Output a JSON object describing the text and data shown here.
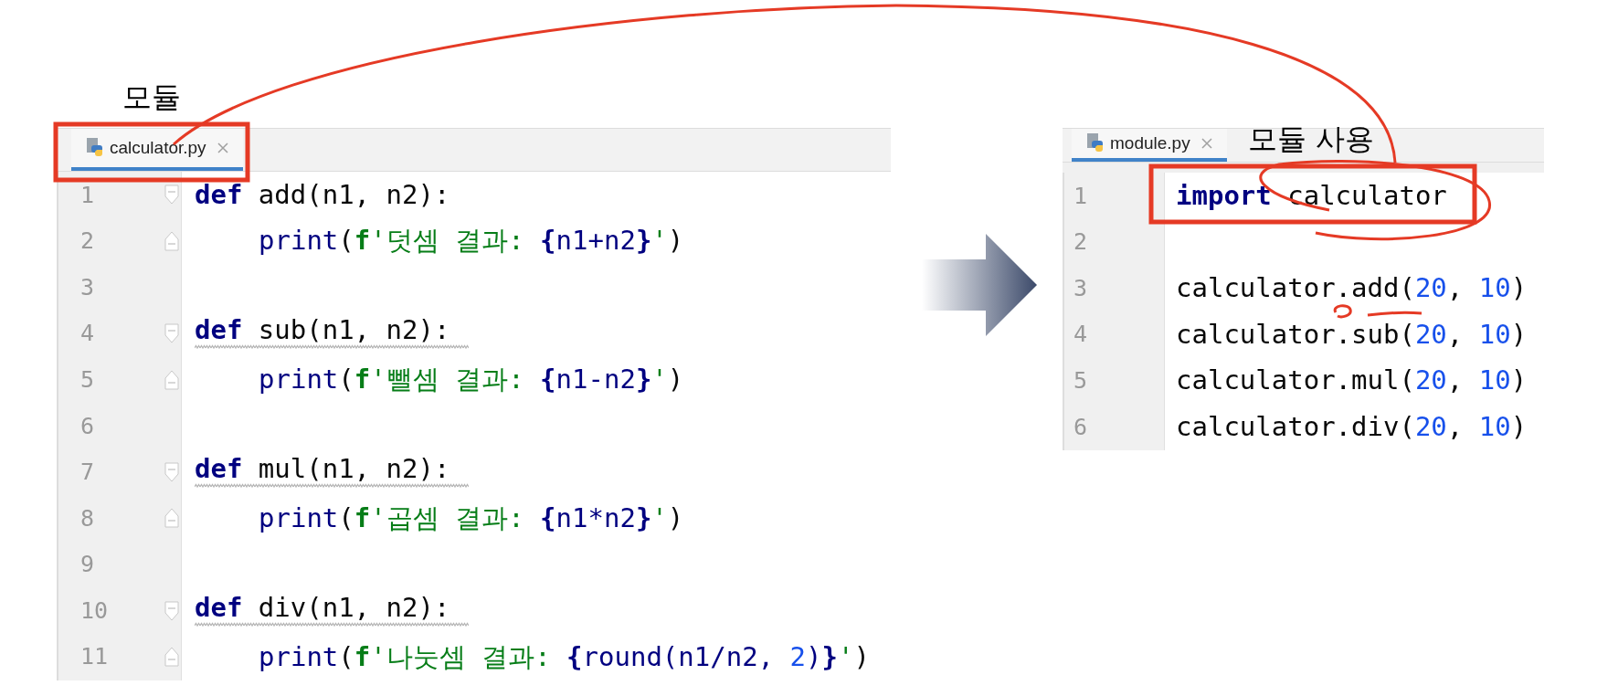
{
  "labels": [
    {
      "text": "모듈",
      "kind": "module"
    },
    {
      "text": "모듈 사용",
      "kind": "usage"
    }
  ],
  "editors": [
    {
      "tab": {
        "label": "calculator.py",
        "selected": true
      },
      "lines": [
        {
          "number": "1",
          "kind": "def",
          "warning": false,
          "tokens": [
            {
              "text": "def",
              "kind": "keyword"
            },
            {
              "text": " add(n1, n2):",
              "kind": "plain"
            }
          ]
        },
        {
          "number": "2",
          "kind": "body",
          "warning": false,
          "tokens": [
            {
              "text": "print",
              "kind": "builtin"
            },
            {
              "text": "(",
              "kind": "plain"
            },
            {
              "text": "f",
              "kind": "prefix"
            },
            {
              "text": "'덧셈 결과: ",
              "kind": "string"
            },
            {
              "text": "{",
              "kind": "brace"
            },
            {
              "text": "n1+n2",
              "kind": "expr"
            },
            {
              "text": "}",
              "kind": "brace"
            },
            {
              "text": "'",
              "kind": "string"
            },
            {
              "text": ")",
              "kind": "plain"
            }
          ]
        },
        {
          "number": "3",
          "kind": "blank"
        },
        {
          "number": "4",
          "kind": "def",
          "warning": true,
          "tokens": [
            {
              "text": "def",
              "kind": "keyword"
            },
            {
              "text": " sub(n1, n2):",
              "kind": "plain"
            }
          ]
        },
        {
          "number": "5",
          "kind": "body",
          "warning": false,
          "tokens": [
            {
              "text": "print",
              "kind": "builtin"
            },
            {
              "text": "(",
              "kind": "plain"
            },
            {
              "text": "f",
              "kind": "prefix"
            },
            {
              "text": "'뺄셈 결과: ",
              "kind": "string"
            },
            {
              "text": "{",
              "kind": "brace"
            },
            {
              "text": "n1-n2",
              "kind": "expr"
            },
            {
              "text": "}",
              "kind": "brace"
            },
            {
              "text": "'",
              "kind": "string"
            },
            {
              "text": ")",
              "kind": "plain"
            }
          ]
        },
        {
          "number": "6",
          "kind": "blank"
        },
        {
          "number": "7",
          "kind": "def",
          "warning": true,
          "tokens": [
            {
              "text": "def",
              "kind": "keyword"
            },
            {
              "text": " mul(n1, n2):",
              "kind": "plain"
            }
          ]
        },
        {
          "number": "8",
          "kind": "body",
          "warning": false,
          "tokens": [
            {
              "text": "print",
              "kind": "builtin"
            },
            {
              "text": "(",
              "kind": "plain"
            },
            {
              "text": "f",
              "kind": "prefix"
            },
            {
              "text": "'곱셈 결과: ",
              "kind": "string"
            },
            {
              "text": "{",
              "kind": "brace"
            },
            {
              "text": "n1*n2",
              "kind": "expr"
            },
            {
              "text": "}",
              "kind": "brace"
            },
            {
              "text": "'",
              "kind": "string"
            },
            {
              "text": ")",
              "kind": "plain"
            }
          ]
        },
        {
          "number": "9",
          "kind": "blank"
        },
        {
          "number": "10",
          "kind": "def",
          "warning": true,
          "tokens": [
            {
              "text": "def",
              "kind": "keyword"
            },
            {
              "text": " div(n1, n2):",
              "kind": "plain"
            }
          ]
        },
        {
          "number": "11",
          "kind": "body",
          "warning": false,
          "tokens": [
            {
              "text": "print",
              "kind": "builtin"
            },
            {
              "text": "(",
              "kind": "plain"
            },
            {
              "text": "f",
              "kind": "prefix"
            },
            {
              "text": "'나눗셈 결과: ",
              "kind": "string"
            },
            {
              "text": "{",
              "kind": "brace"
            },
            {
              "text": "round(n1/n2, ",
              "kind": "expr"
            },
            {
              "text": "2",
              "kind": "number"
            },
            {
              "text": ")",
              "kind": "expr"
            },
            {
              "text": "}",
              "kind": "brace"
            },
            {
              "text": "'",
              "kind": "string"
            },
            {
              "text": ")",
              "kind": "plain"
            }
          ]
        }
      ]
    },
    {
      "tab": {
        "label": "module.py",
        "selected": true
      },
      "lines": [
        {
          "number": "1",
          "kind": "top",
          "warning": false,
          "tokens": [
            {
              "text": "import",
              "kind": "keyword"
            },
            {
              "text": " calculator",
              "kind": "plain"
            }
          ]
        },
        {
          "number": "2",
          "kind": "blank"
        },
        {
          "number": "3",
          "kind": "top",
          "warning": false,
          "tokens": [
            {
              "text": "calculator.add(",
              "kind": "plain"
            },
            {
              "text": "20",
              "kind": "number"
            },
            {
              "text": ", ",
              "kind": "plain"
            },
            {
              "text": "10",
              "kind": "number"
            },
            {
              "text": ")",
              "kind": "plain"
            }
          ]
        },
        {
          "number": "4",
          "kind": "top",
          "warning": false,
          "tokens": [
            {
              "text": "calculator.sub(",
              "kind": "plain"
            },
            {
              "text": "20",
              "kind": "number"
            },
            {
              "text": ", ",
              "kind": "plain"
            },
            {
              "text": "10",
              "kind": "number"
            },
            {
              "text": ")",
              "kind": "plain"
            }
          ]
        },
        {
          "number": "5",
          "kind": "top",
          "warning": false,
          "tokens": [
            {
              "text": "calculator.mul(",
              "kind": "plain"
            },
            {
              "text": "20",
              "kind": "number"
            },
            {
              "text": ", ",
              "kind": "plain"
            },
            {
              "text": "10",
              "kind": "number"
            },
            {
              "text": ")",
              "kind": "plain"
            }
          ]
        },
        {
          "number": "6",
          "kind": "top",
          "warning": false,
          "tokens": [
            {
              "text": "calculator.div(",
              "kind": "plain"
            },
            {
              "text": "20",
              "kind": "number"
            },
            {
              "text": ", ",
              "kind": "plain"
            },
            {
              "text": "10",
              "kind": "number"
            },
            {
              "text": ")",
              "kind": "plain"
            }
          ]
        }
      ]
    }
  ]
}
